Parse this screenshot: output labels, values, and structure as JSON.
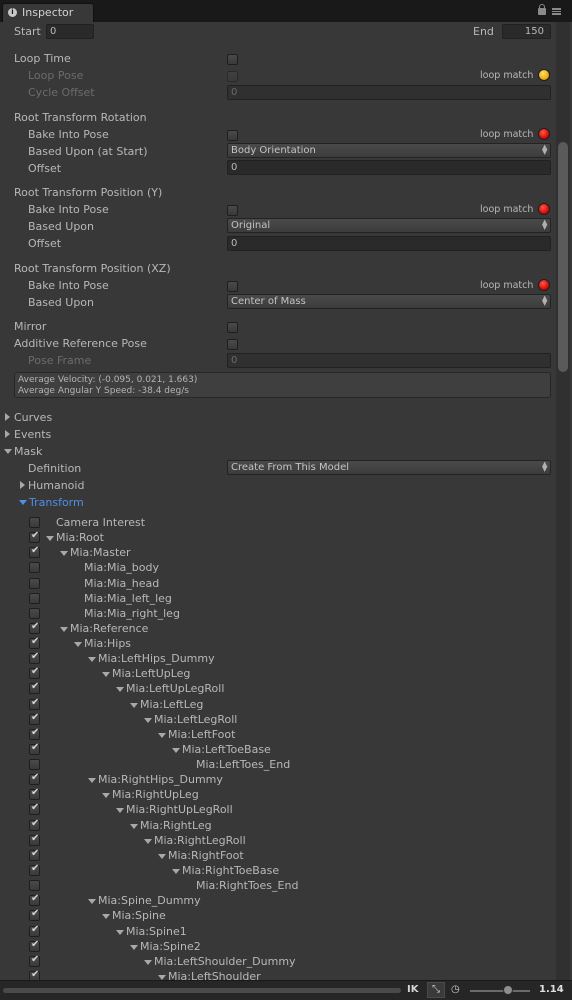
{
  "window": {
    "tab_title": "Inspector"
  },
  "range": {
    "start_label": "Start",
    "start_value": "0",
    "end_label": "End",
    "end_value": "150"
  },
  "loop": {
    "loop_time": "Loop Time",
    "loop_pose": "Loop Pose",
    "cycle_offset": "Cycle Offset",
    "cycle_offset_value": "0",
    "loop_match": "loop match"
  },
  "rotation": {
    "header": "Root Transform Rotation",
    "bake": "Bake Into Pose",
    "based_upon": "Based Upon (at Start)",
    "based_value": "Body Orientation",
    "offset": "Offset",
    "offset_value": "0",
    "loop_match": "loop match"
  },
  "position_y": {
    "header": "Root Transform Position (Y)",
    "bake": "Bake Into Pose",
    "based_upon": "Based Upon",
    "based_value": "Original",
    "offset": "Offset",
    "offset_value": "0",
    "loop_match": "loop match"
  },
  "position_xz": {
    "header": "Root Transform Position (XZ)",
    "bake": "Bake Into Pose",
    "based_upon": "Based Upon",
    "based_value": "Center of Mass",
    "loop_match": "loop match"
  },
  "mirror": "Mirror",
  "additive": {
    "label": "Additive Reference Pose",
    "pose_frame": "Pose Frame",
    "pose_frame_value": "0"
  },
  "info": {
    "velocity": "Average Velocity: (-0.095, 0.021, 1.663)",
    "angular": "Average Angular Y Speed: -38.4 deg/s"
  },
  "sections": {
    "curves": "Curves",
    "events": "Events",
    "mask": "Mask"
  },
  "mask": {
    "definition": "Definition",
    "definition_value": "Create From This Model",
    "humanoid": "Humanoid",
    "transform": "Transform"
  },
  "tree": [
    "Camera Interest",
    "Mia:Root",
    "Mia:Master",
    "Mia:Mia_body",
    "Mia:Mia_head",
    "Mia:Mia_left_leg",
    "Mia:Mia_right_leg",
    "Mia:Reference",
    "Mia:Hips",
    "Mia:LeftHips_Dummy",
    "Mia:LeftUpLeg",
    "Mia:LeftUpLegRoll",
    "Mia:LeftLeg",
    "Mia:LeftLegRoll",
    "Mia:LeftFoot",
    "Mia:LeftToeBase",
    "Mia:LeftToes_End",
    "Mia:RightHips_Dummy",
    "Mia:RightUpLeg",
    "Mia:RightUpLegRoll",
    "Mia:RightLeg",
    "Mia:RightLegRoll",
    "Mia:RightFoot",
    "Mia:RightToeBase",
    "Mia:RightToes_End",
    "Mia:Spine_Dummy",
    "Mia:Spine",
    "Mia:Spine1",
    "Mia:Spine2",
    "Mia:LeftShoulder_Dummy",
    "Mia:LeftShoulder"
  ],
  "tree_checked": [
    false,
    true,
    true,
    false,
    false,
    false,
    false,
    true,
    true,
    true,
    true,
    true,
    true,
    true,
    true,
    true,
    false,
    true,
    true,
    true,
    true,
    true,
    true,
    true,
    false,
    true,
    true,
    true,
    true,
    true,
    true
  ],
  "bottom": {
    "ik": "IK",
    "pivot": "⤡",
    "speed_icon": "◷",
    "value": "1.14"
  }
}
